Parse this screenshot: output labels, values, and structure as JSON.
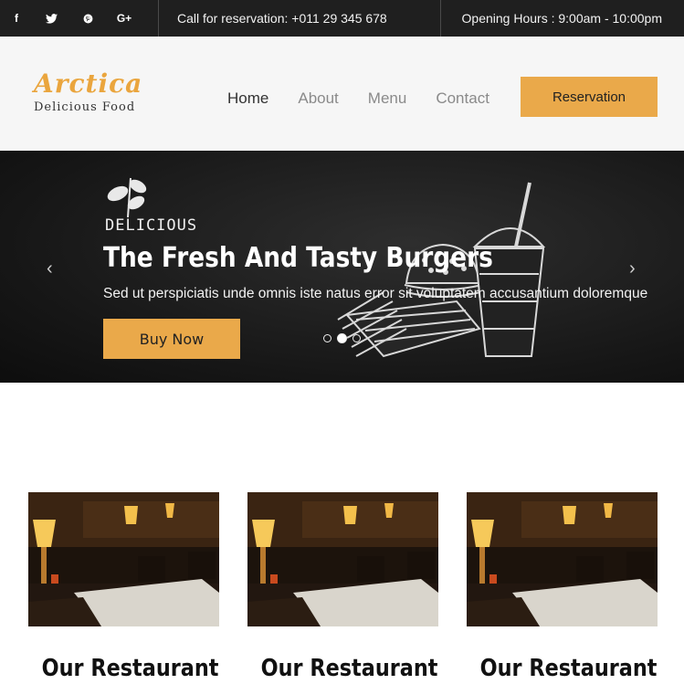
{
  "topbar": {
    "social": [
      {
        "icon": "facebook-icon",
        "glyph": "f"
      },
      {
        "icon": "twitter-icon",
        "glyph": "🐦"
      },
      {
        "icon": "pinterest-icon",
        "glyph": "℗"
      },
      {
        "icon": "google-plus-icon",
        "glyph": "G+"
      }
    ],
    "call": "Call for reservation: +011 29 345 678",
    "hours": "Opening Hours : 9:00am - 10:00pm"
  },
  "header": {
    "logo_title": "Arctica",
    "logo_subtitle": "Delicious Food",
    "nav": [
      "Home",
      "About",
      "Menu",
      "Contact"
    ],
    "active_nav": "Home",
    "reservation_label": "Reservation"
  },
  "hero": {
    "kicker": "DELICIOUS",
    "title": "The Fresh And Tasty Burgers",
    "text": "Sed ut perspiciatis unde omnis iste natus error sit voluptatem accusantium doloremque",
    "button_label": "Buy Now",
    "prev_arrow": "‹",
    "next_arrow": "›",
    "slides": 3,
    "active_slide": 2
  },
  "cards": [
    {
      "title": "Our Restaurant"
    },
    {
      "title": "Our Restaurant"
    },
    {
      "title": "Our Restaurant"
    }
  ],
  "colors": {
    "accent": "#eaa94a",
    "topbar_bg": "#1f1f1f",
    "header_bg": "#f6f6f6"
  }
}
